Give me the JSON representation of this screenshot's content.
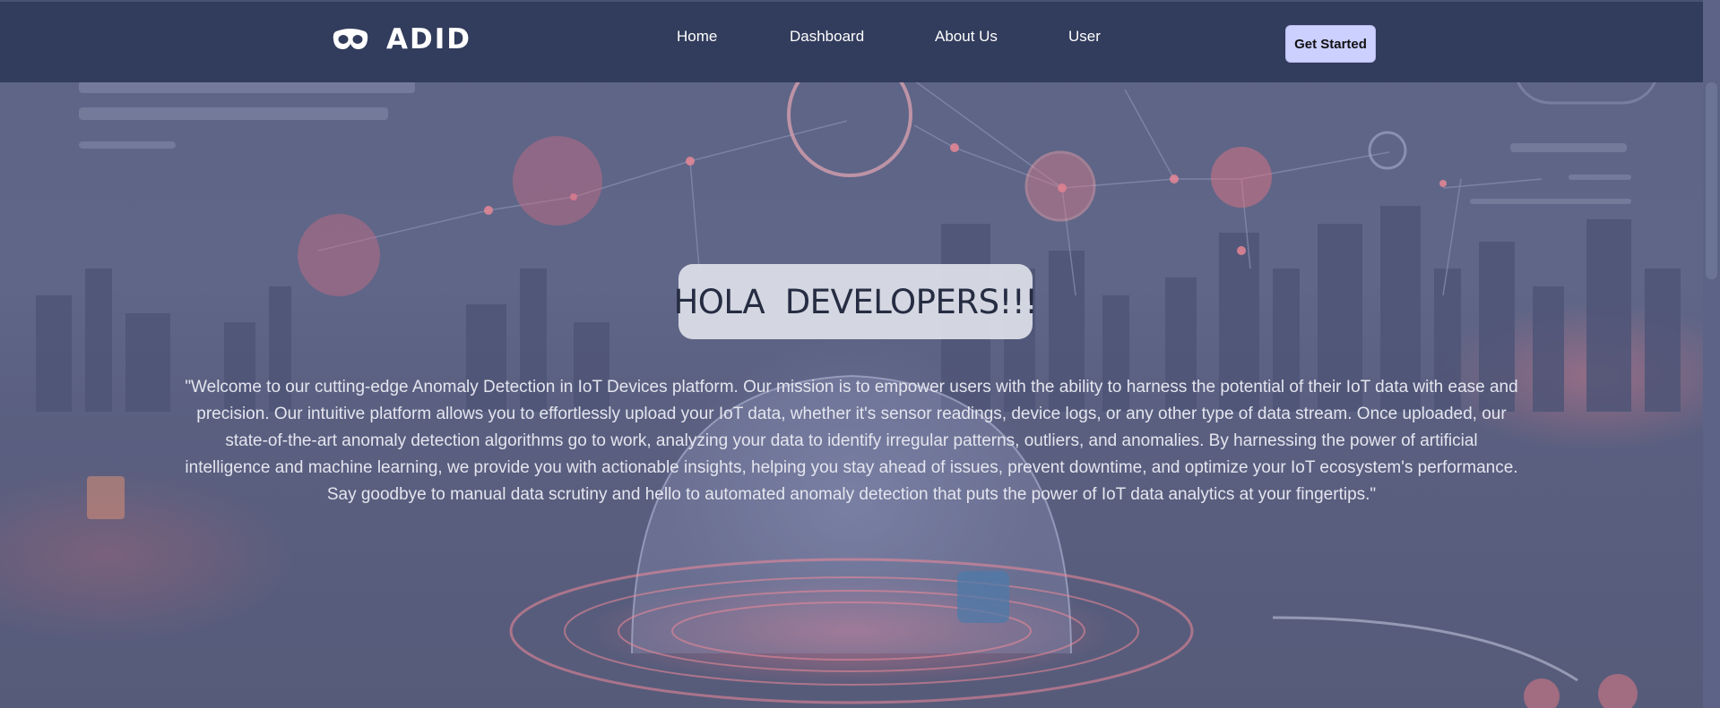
{
  "brand": {
    "logo_icon": "mask-icon",
    "name": "ADID"
  },
  "nav": {
    "items": [
      {
        "label": "Home"
      },
      {
        "label": "Dashboard"
      },
      {
        "label": "About Us"
      },
      {
        "label": "User"
      }
    ],
    "cta_label": "Get Started"
  },
  "hero": {
    "title": "HOLA  DEVELOPERS!!!",
    "description": "\"Welcome to our cutting-edge Anomaly Detection in IoT Devices platform. Our mission is to empower users with the ability to harness the potential of their IoT data with ease and precision. Our intuitive platform allows you to effortlessly upload your IoT data, whether it's sensor readings, device logs, or any other type of data stream. Once uploaded, our state-of-the-art anomaly detection algorithms go to work, analyzing your data to identify irregular patterns, outliers, and anomalies. By harnessing the power of artificial intelligence and machine learning, we provide you with actionable insights, helping you stay ahead of issues, prevent downtime, and optimize your IoT ecosystem's performance. Say goodbye to manual data scrutiny and hello to automated anomaly detection that puts the power of IoT data analytics at your fingertips.\""
  },
  "colors": {
    "nav_background": "#323c5c",
    "cta_background": "#ccd0ff",
    "badge_background": "#e1e3eb"
  }
}
